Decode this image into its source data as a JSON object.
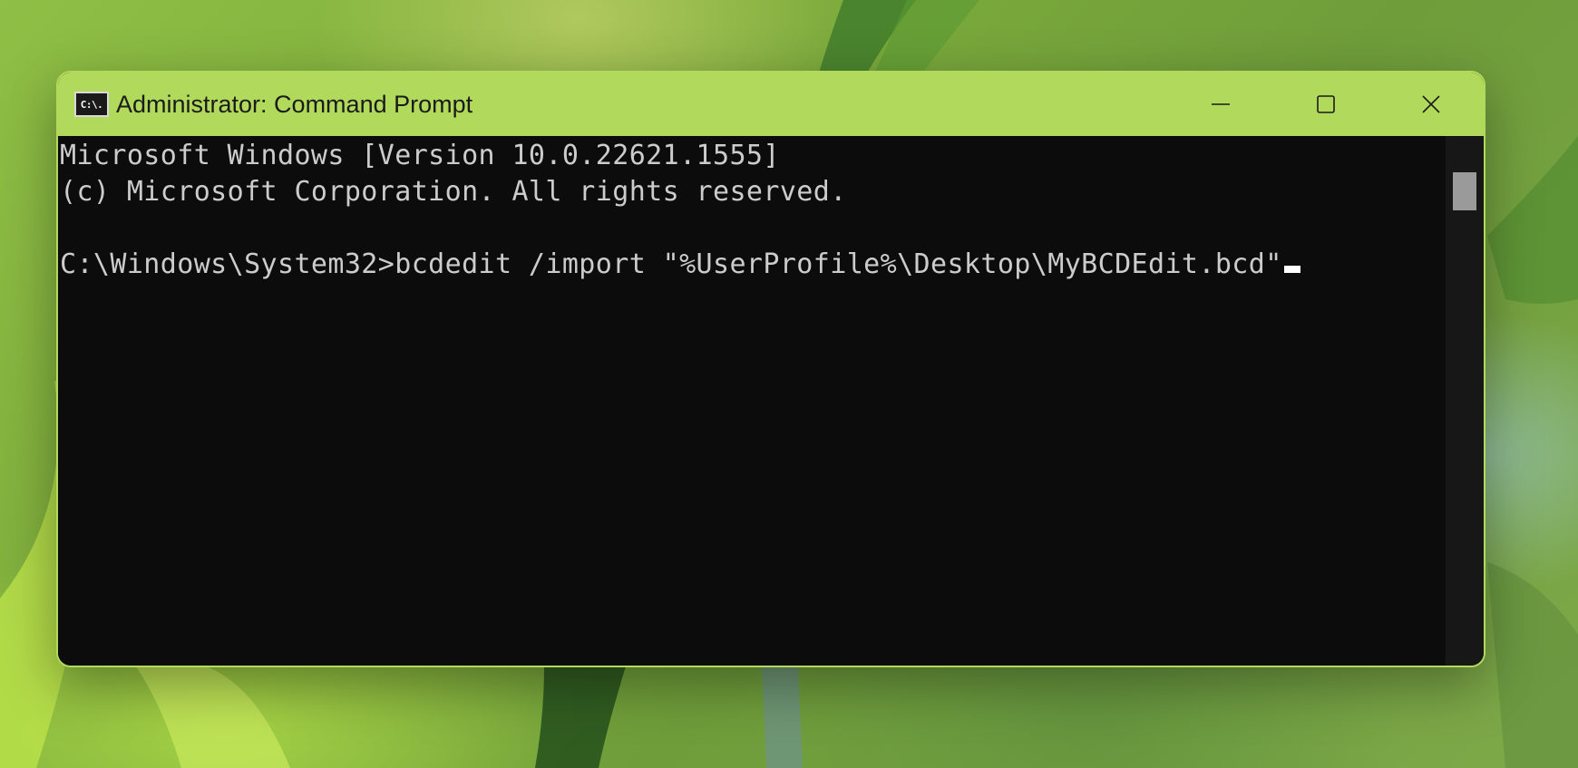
{
  "window": {
    "title": "Administrator: Command Prompt",
    "icon": "cmd-icon",
    "icon_text": "C:\\.",
    "controls": {
      "minimize_icon": "minimize-icon",
      "maximize_icon": "maximize-icon",
      "close_icon": "close-icon"
    },
    "accent_color": "#b1d95b"
  },
  "console": {
    "lines": [
      "Microsoft Windows [Version 10.0.22621.1555]",
      "(c) Microsoft Corporation. All rights reserved.",
      "",
      "C:\\Windows\\System32>bcdedit /import \"%UserProfile%\\Desktop\\MyBCDEdit.bcd\""
    ],
    "background": "#0c0c0c",
    "text_color": "#cccccc"
  }
}
